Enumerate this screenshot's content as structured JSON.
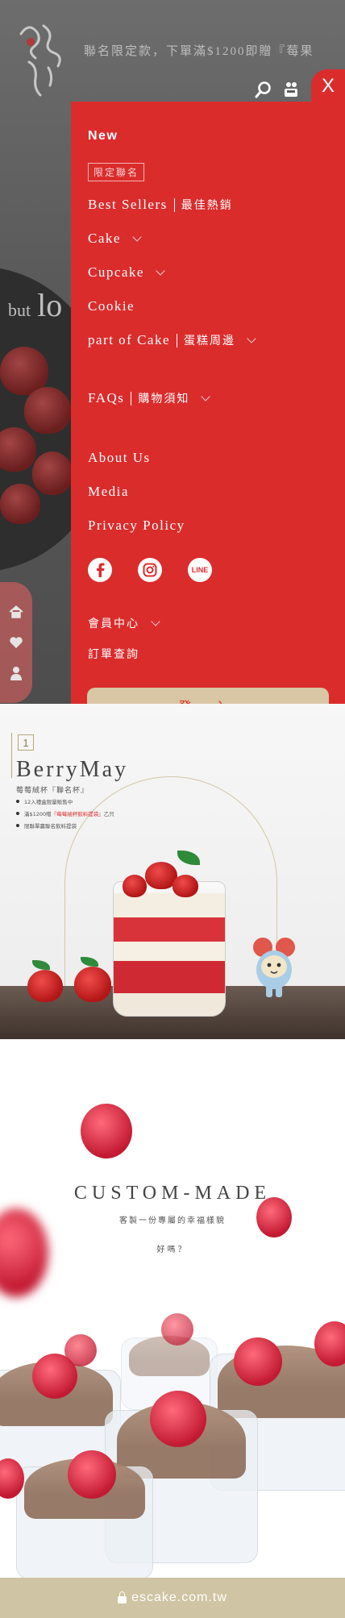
{
  "header": {
    "marquee": "聯名限定款，下單滿$1200即贈『莓果",
    "search_icon": "search-icon",
    "cart_icon": "cart-icon",
    "close_label": "X"
  },
  "hero": {
    "text_small": "but",
    "text_large": "lo"
  },
  "menu": {
    "new_label": "New",
    "badge": "限定聯名",
    "best_sellers_en": "Best Sellers",
    "best_sellers_cn": "最佳熱銷",
    "cake": "Cake",
    "cupcake": "Cupcake",
    "cookie": "Cookie",
    "part_of_cake_en": "part of Cake",
    "part_of_cake_cn": "蛋糕周邊",
    "faqs_en": "FAQs",
    "faqs_cn": "購物須知",
    "about": "About Us",
    "media": "Media",
    "privacy": "Privacy Policy",
    "social": [
      "facebook-icon",
      "instagram-icon",
      "line-icon"
    ],
    "line_text": "LINE",
    "member_center": "會員中心",
    "order_query": "訂單查詢",
    "login": "登 入"
  },
  "side_tabs": [
    "home-icon",
    "heart-icon",
    "user-icon"
  ],
  "berrymay": {
    "number": "1",
    "title": "BerryMay",
    "subtitle": "莓莓絨杯『聯名杯』",
    "bullets": [
      {
        "text": "12入禮盒限量販售中",
        "highlight": ""
      },
      {
        "text": "滿$1200贈",
        "highlight": "『莓莓絨杯飲料提袋』",
        "after": "乙只"
      },
      {
        "text": "限聯單贏聯名飲料提袋",
        "highlight": ""
      }
    ]
  },
  "custom": {
    "title": "CUSTOM-MADE",
    "subtitle": "客製一份專屬的幸福樣貌",
    "question": "好嗎？"
  },
  "urlbar": {
    "url": "escake.com.tw"
  },
  "colors": {
    "menu_red": "#db2c2c",
    "gold": "#d9c6a4",
    "url_bg": "#cfc4a3"
  }
}
